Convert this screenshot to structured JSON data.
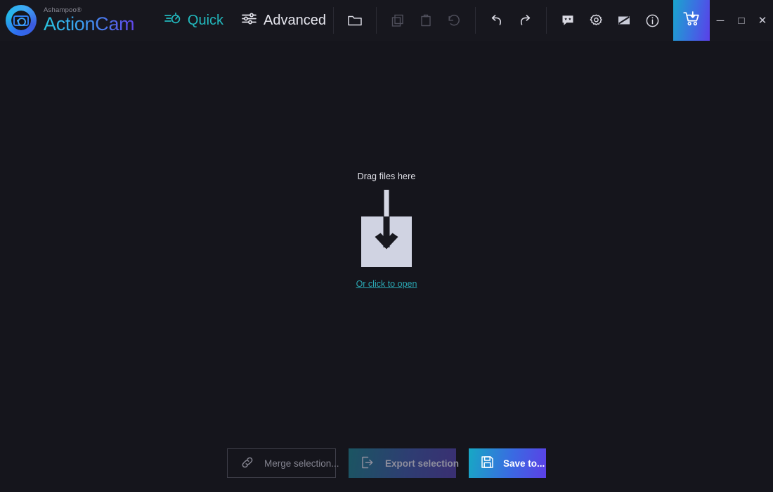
{
  "app": {
    "vendor": "Ashampoo®",
    "name": "ActionCam",
    "logo_icon": "action-camera-logo-icon",
    "accent_teal": "#22b8bd",
    "accent_purple": "#5c3fe6",
    "background": "#15151c",
    "titlebar_background": "#17171e"
  },
  "nav": {
    "tabs": [
      {
        "id": "quick",
        "label": "Quick",
        "icon": "speed-stopwatch-icon",
        "active": true
      },
      {
        "id": "advanced",
        "label": "Advanced",
        "icon": "sliders-icon",
        "active": false
      }
    ]
  },
  "toolbar": {
    "groups": [
      {
        "id": "file",
        "items": [
          {
            "id": "open-folder",
            "icon": "folder-icon",
            "enabled": true
          }
        ]
      },
      {
        "id": "edit",
        "items": [
          {
            "id": "copy",
            "icon": "copy-icon",
            "enabled": false
          },
          {
            "id": "paste",
            "icon": "clipboard-paste-icon",
            "enabled": false
          },
          {
            "id": "reset",
            "icon": "reset-rotate-icon",
            "enabled": false
          }
        ]
      },
      {
        "id": "history",
        "items": [
          {
            "id": "undo",
            "icon": "undo-arrow-icon",
            "enabled": true
          },
          {
            "id": "redo",
            "icon": "redo-arrow-icon",
            "enabled": true
          }
        ]
      },
      {
        "id": "app",
        "items": [
          {
            "id": "feedback",
            "icon": "rating-speech-bubble-icon",
            "enabled": true
          },
          {
            "id": "settings",
            "icon": "gear-icon",
            "enabled": true
          },
          {
            "id": "theme",
            "icon": "theme-contrast-icon",
            "enabled": true
          },
          {
            "id": "info",
            "icon": "info-circle-icon",
            "enabled": true
          }
        ]
      }
    ],
    "cart": {
      "id": "buy",
      "icon": "shopping-cart-download-icon"
    }
  },
  "window_controls": {
    "minimize": {
      "label": "─",
      "icon": "minimize-icon"
    },
    "maximize": {
      "label": "□",
      "icon": "maximize-icon"
    },
    "close": {
      "label": "✕",
      "icon": "close-icon"
    }
  },
  "dropzone": {
    "title": "Drag files here",
    "icon": "download-into-box-icon",
    "link": "Or click to open"
  },
  "actions": [
    {
      "id": "merge",
      "label": "Merge selection...",
      "icon": "chain-link-icon",
      "state": "disabled",
      "style": "outline"
    },
    {
      "id": "export",
      "label": "Export selection",
      "icon": "export-arrow-icon",
      "state": "disabled",
      "style": "gradient-muted"
    },
    {
      "id": "save",
      "label": "Save to...",
      "icon": "floppy-save-icon",
      "state": "enabled",
      "style": "gradient-bright"
    }
  ]
}
